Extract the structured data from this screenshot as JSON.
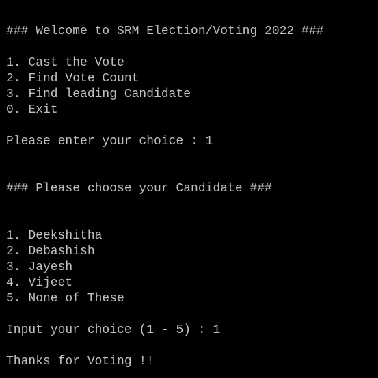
{
  "console": {
    "welcome_banner": "### Welcome to SRM Election/Voting 2022 ###",
    "main_menu": [
      "1. Cast the Vote",
      "2. Find Vote Count",
      "3. Find leading Candidate",
      "0. Exit"
    ],
    "choice_prompt": "Please enter your choice : 1",
    "candidate_banner": "### Please choose your Candidate ###",
    "candidates": [
      "1. Deekshitha",
      "2. Debashish",
      "3. Jayesh",
      "4. Vijeet",
      "5. None of These"
    ],
    "candidate_prompt": "Input your choice (1 - 5) : 1",
    "thanks_message": "Thanks for Voting !!"
  },
  "colors": {
    "background": "#000000",
    "text": "#c0c0c0"
  }
}
